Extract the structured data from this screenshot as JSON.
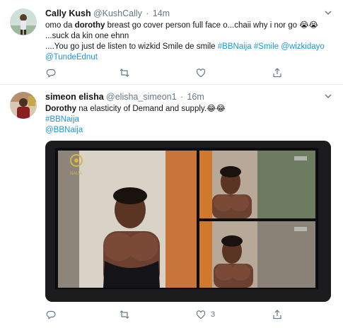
{
  "tweets": [
    {
      "name": "Cally Kush",
      "handle": "@KushCally",
      "time": "14m",
      "segments": [
        {
          "t": "omo da ",
          "s": "text"
        },
        {
          "t": "dorothy",
          "s": "bold"
        },
        {
          "t": " breast go cover person full face o...chaii why i nor go 😭😭",
          "s": "text"
        },
        {
          "t": "\n...suck da kin one ehnn",
          "s": "text"
        },
        {
          "t": "\n....You go just de listen to wizkid Smile de smile ",
          "s": "text"
        },
        {
          "t": "#BBNaija",
          "s": "link"
        },
        {
          "t": " ",
          "s": "text"
        },
        {
          "t": "#Smile",
          "s": "link"
        },
        {
          "t": " ",
          "s": "text"
        },
        {
          "t": "@wizkidayo",
          "s": "link"
        },
        {
          "t": "\n",
          "s": "text"
        },
        {
          "t": "@TundeEdnut",
          "s": "link"
        }
      ],
      "likes": ""
    },
    {
      "name": "simeon elisha",
      "handle": "@elisha_simeon1",
      "time": "16m",
      "segments": [
        {
          "t": "Dorothy",
          "s": "bold"
        },
        {
          "t": " na elasticity of Demand and supply.😂😂",
          "s": "text"
        },
        {
          "t": "\n",
          "s": "text"
        },
        {
          "t": "#BBNaija",
          "s": "link"
        },
        {
          "t": "\n",
          "s": "text"
        },
        {
          "t": "@BBNaija",
          "s": "link"
        }
      ],
      "likes": "3",
      "media": {
        "tv_logo": "NAIJA"
      }
    }
  ],
  "icons": {
    "reply": "reply-icon",
    "retweet": "retweet-icon",
    "like": "heart-icon",
    "share": "share-icon",
    "menu": "chevron-down-icon"
  },
  "colors": {
    "link": "#1b95e0",
    "muted": "#657786",
    "text": "#14171a",
    "divider": "#e6ecf0"
  }
}
